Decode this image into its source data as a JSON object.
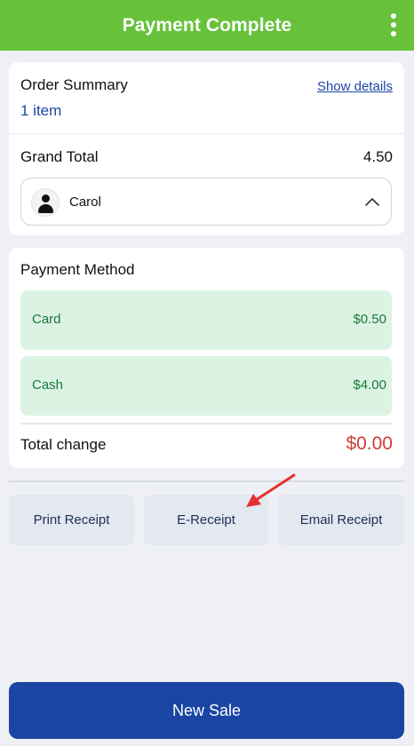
{
  "header": {
    "title": "Payment Complete",
    "menu_icon": "more-vertical-icon"
  },
  "order_summary": {
    "title": "Order Summary",
    "item_count": "1 item",
    "show_details_label": "Show details",
    "grand_total_label": "Grand Total",
    "grand_total_value": "4.50",
    "customer": {
      "name": "Carol",
      "avatar_icon": "user-icon",
      "toggle_icon": "chevron-up-icon"
    }
  },
  "payment": {
    "title": "Payment Method",
    "methods": [
      {
        "label": "Card",
        "amount": "$0.50"
      },
      {
        "label": "Cash",
        "amount": "$4.00"
      }
    ],
    "change_label": "Total change",
    "change_value": "$0.00"
  },
  "receipts": {
    "print_label": "Print Receipt",
    "ereceipt_label": "E-Receipt",
    "email_label": "Email Receipt"
  },
  "footer": {
    "new_sale_label": "New Sale"
  },
  "colors": {
    "header_bg": "#67c23a",
    "primary": "#1a45a2",
    "link": "#1e46a6",
    "payment_row_bg": "#dcf3e3",
    "payment_text": "#177a3a",
    "change_value": "#d23a35",
    "annotation_arrow": "#e53030"
  }
}
